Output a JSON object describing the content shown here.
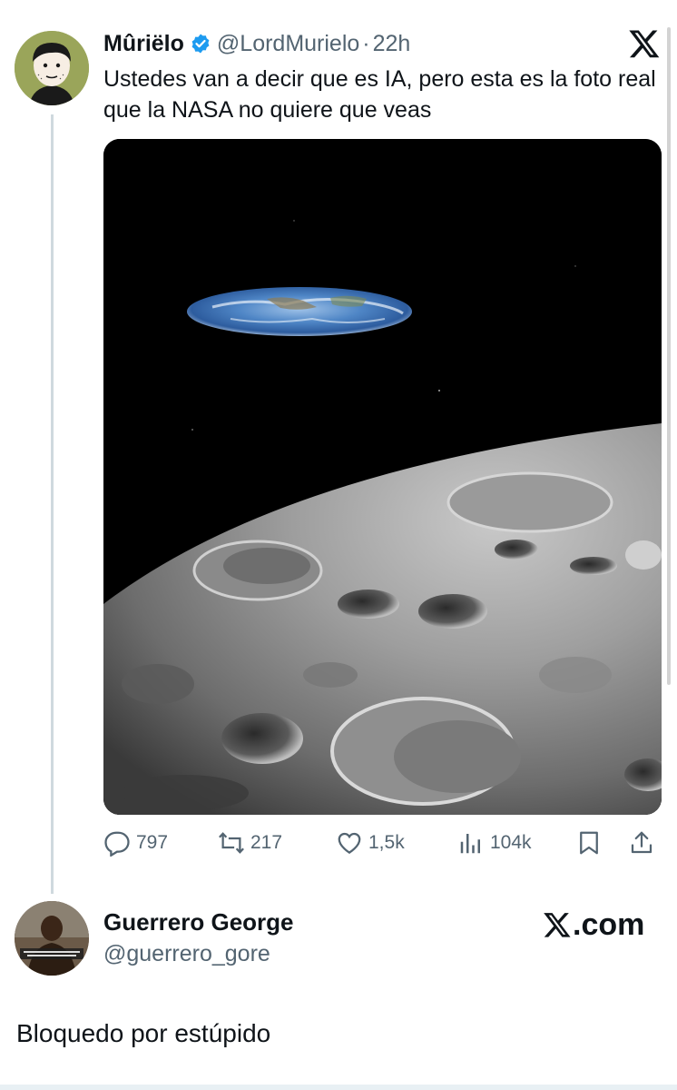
{
  "tweet": {
    "display_name": "Mûriëlo",
    "handle": "@LordMurielo",
    "separator": "·",
    "time": "22h",
    "text": "Ustedes van a decir que es IA, pero esta es la foto real que la NASA no quiere que veas",
    "verified": true,
    "media_description_icon": "flat-earth-over-moon-image",
    "stats": {
      "replies": "797",
      "retweets": "217",
      "likes": "1,5k",
      "views": "104k"
    }
  },
  "reply": {
    "display_name": "Guerrero George",
    "handle": "@guerrero_gore",
    "brand": ".com",
    "brand_icon": "x-logo-icon"
  },
  "comment_text": "Bloquedo por estúpido",
  "colors": {
    "verified_blue": "#1d9bf0",
    "secondary_text": "#536471",
    "primary_text": "#0f1419",
    "thread_line": "#cfd9de"
  }
}
